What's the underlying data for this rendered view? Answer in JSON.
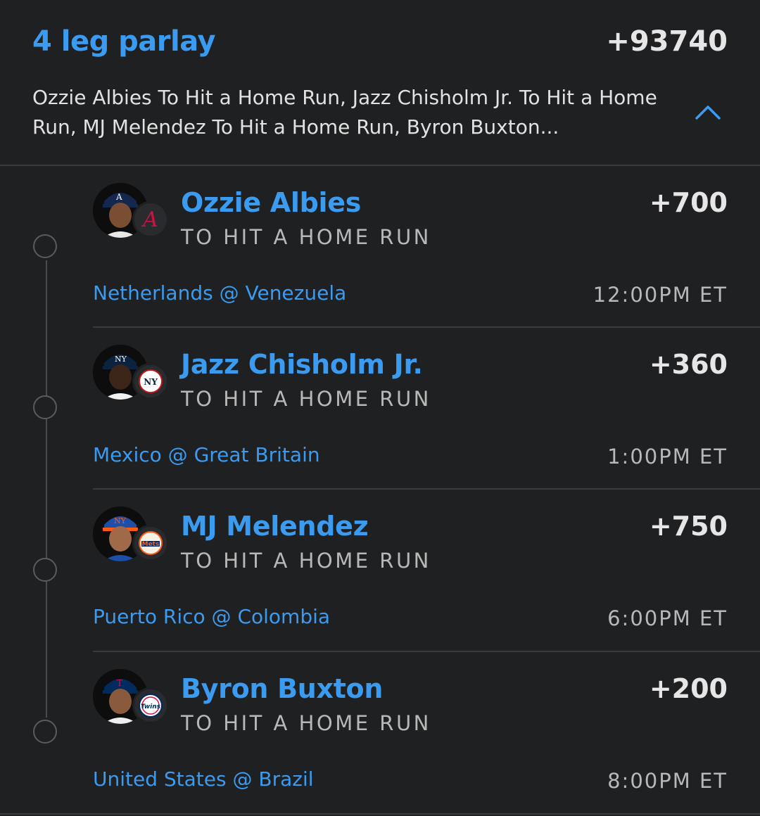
{
  "parlay": {
    "title": "4 leg parlay",
    "odds": "+93740",
    "description": "Ozzie Albies To Hit a Home Run, Jazz Chisholm Jr. To Hit a Home Run, MJ Melendez To Hit a Home Run, Byron Buxton..."
  },
  "icons": {
    "collapse": "chevron-up-icon",
    "avatar": "player-headshot-icon"
  },
  "colors": {
    "accent": "#3a9bf1",
    "background": "#1f2022",
    "text": "#e6e6e6",
    "muted": "#b8b8b8"
  },
  "legs": [
    {
      "player": "Ozzie Albies",
      "market": "TO HIT A HOME RUN",
      "odds": "+700",
      "matchup": "Netherlands @ Venezuela",
      "time": "12:00PM ET",
      "team_logo": "braves-logo-icon"
    },
    {
      "player": "Jazz Chisholm Jr.",
      "market": "TO HIT A HOME RUN",
      "odds": "+360",
      "matchup": "Mexico @ Great Britain",
      "time": "1:00PM ET",
      "team_logo": "yankees-logo-icon"
    },
    {
      "player": "MJ Melendez",
      "market": "TO HIT A HOME RUN",
      "odds": "+750",
      "matchup": "Puerto Rico @ Colombia",
      "time": "6:00PM ET",
      "team_logo": "mets-logo-icon"
    },
    {
      "player": "Byron Buxton",
      "market": "TO HIT A HOME RUN",
      "odds": "+200",
      "matchup": "United States @ Brazil",
      "time": "8:00PM ET",
      "team_logo": "twins-logo-icon"
    }
  ]
}
